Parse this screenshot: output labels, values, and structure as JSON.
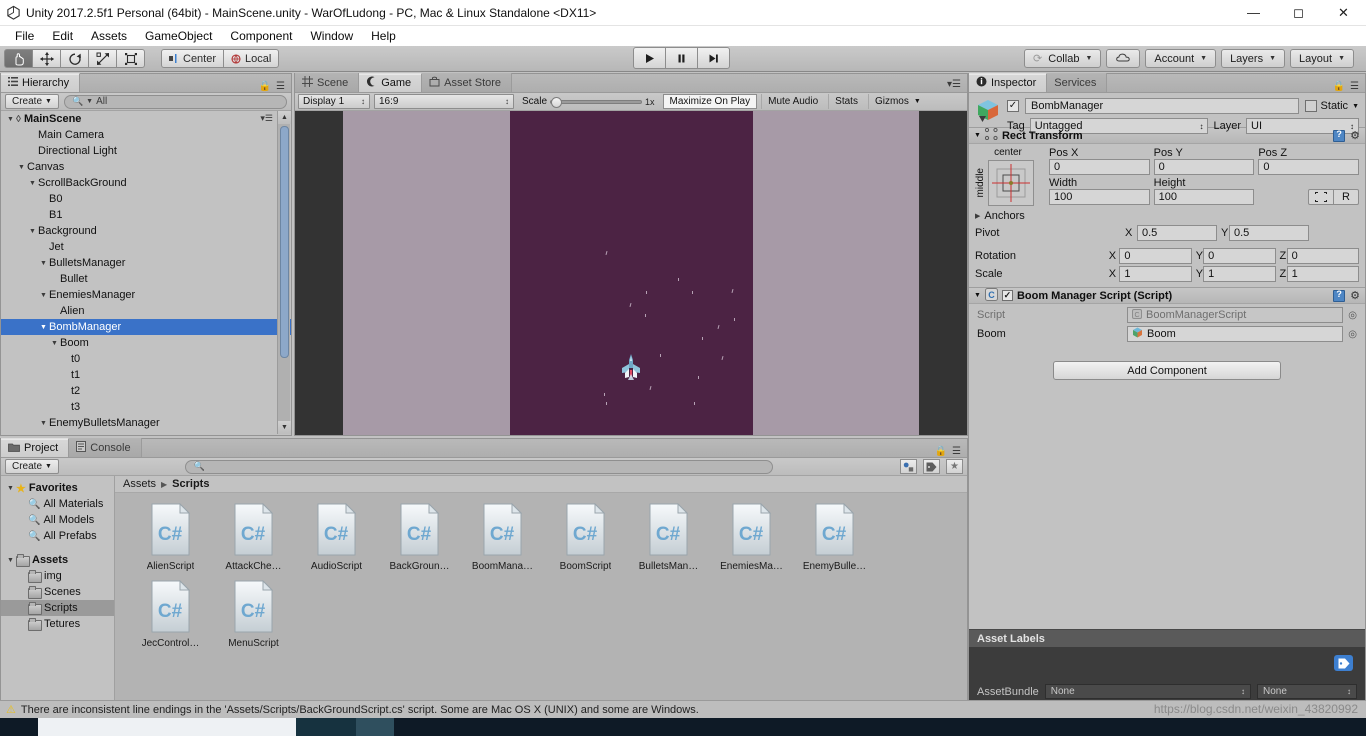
{
  "window": {
    "title": "Unity 2017.2.5f1 Personal (64bit) - MainScene.unity - WarOfLudong - PC, Mac & Linux Standalone <DX11>",
    "logo_icon": "unity-logo-icon",
    "minimize_icon": "minimize-icon",
    "maximize_icon": "maximize-icon",
    "close_icon": "close-icon"
  },
  "menubar": {
    "items": [
      "File",
      "Edit",
      "Assets",
      "GameObject",
      "Component",
      "Window",
      "Help"
    ]
  },
  "toolbar": {
    "tools": [
      {
        "name": "hand-tool",
        "icon": "✋",
        "active": true
      },
      {
        "name": "move-tool",
        "icon": "✥",
        "active": false
      },
      {
        "name": "rotate-tool",
        "icon": "↻",
        "active": false
      },
      {
        "name": "scale-tool",
        "icon": "⤢",
        "active": false
      },
      {
        "name": "rect-tool",
        "icon": "▣",
        "active": false
      }
    ],
    "pivot_mode": "Center",
    "pivot_rotation": "Local",
    "play": "▶",
    "pause": "❙❙",
    "step": "▶❙",
    "collab": "Collab",
    "cloud_icon": "cloud-icon",
    "account": "Account",
    "layers": "Layers",
    "layout": "Layout"
  },
  "hierarchy": {
    "tab": "Hierarchy",
    "create_button": "Create",
    "search_placeholder": "All",
    "rows": [
      {
        "label": "MainScene",
        "depth": 0,
        "arrow": "▼",
        "root": true,
        "selected": false
      },
      {
        "label": "Main Camera",
        "depth": 2,
        "arrow": "",
        "root": false,
        "selected": false
      },
      {
        "label": "Directional Light",
        "depth": 2,
        "arrow": "",
        "root": false,
        "selected": false
      },
      {
        "label": "Canvas",
        "depth": 1,
        "arrow": "▼",
        "root": false,
        "selected": false
      },
      {
        "label": "ScrollBackGround",
        "depth": 2,
        "arrow": "▼",
        "root": false,
        "selected": false
      },
      {
        "label": "B0",
        "depth": 3,
        "arrow": "",
        "root": false,
        "selected": false
      },
      {
        "label": "B1",
        "depth": 3,
        "arrow": "",
        "root": false,
        "selected": false
      },
      {
        "label": "Background",
        "depth": 2,
        "arrow": "▼",
        "root": false,
        "selected": false
      },
      {
        "label": "Jet",
        "depth": 3,
        "arrow": "",
        "root": false,
        "selected": false
      },
      {
        "label": "BulletsManager",
        "depth": 3,
        "arrow": "▼",
        "root": false,
        "selected": false
      },
      {
        "label": "Bullet",
        "depth": 4,
        "arrow": "",
        "root": false,
        "selected": false
      },
      {
        "label": "EnemiesManager",
        "depth": 3,
        "arrow": "▼",
        "root": false,
        "selected": false
      },
      {
        "label": "Alien",
        "depth": 4,
        "arrow": "",
        "root": false,
        "selected": false
      },
      {
        "label": "BombManager",
        "depth": 3,
        "arrow": "▼",
        "root": false,
        "selected": true
      },
      {
        "label": "Boom",
        "depth": 4,
        "arrow": "▼",
        "root": false,
        "selected": false
      },
      {
        "label": "t0",
        "depth": 5,
        "arrow": "",
        "root": false,
        "selected": false
      },
      {
        "label": "t1",
        "depth": 5,
        "arrow": "",
        "root": false,
        "selected": false
      },
      {
        "label": "t2",
        "depth": 5,
        "arrow": "",
        "root": false,
        "selected": false
      },
      {
        "label": "t3",
        "depth": 5,
        "arrow": "",
        "root": false,
        "selected": false
      },
      {
        "label": "EnemyBulletsManager",
        "depth": 3,
        "arrow": "▼",
        "root": false,
        "selected": false
      }
    ]
  },
  "gamepanel": {
    "tabs": [
      {
        "label": "Scene",
        "icon": "grid-icon",
        "active": false
      },
      {
        "label": "Game",
        "icon": "gamepad-icon",
        "active": true
      },
      {
        "label": "Asset Store",
        "icon": "store-icon",
        "active": false
      }
    ],
    "display": "Display 1",
    "aspect": "16:9",
    "scale_label": "Scale",
    "scale_value": "1x",
    "maximize_on_play": "Maximize On Play",
    "mute_audio": "Mute Audio",
    "stats": "Stats",
    "gizmos": "Gizmos"
  },
  "inspector": {
    "tabs": [
      {
        "label": "Inspector",
        "active": true
      },
      {
        "label": "Services",
        "active": false
      }
    ],
    "object_name": "BombManager",
    "enabled": true,
    "static_label": "Static",
    "tag_label": "Tag",
    "tag_value": "Untagged",
    "layer_label": "Layer",
    "layer_value": "UI",
    "rect_transform": {
      "title": "Rect Transform",
      "anchor_preset_top": "center",
      "anchor_preset_side": "middle",
      "pos_x_label": "Pos X",
      "pos_x": "0",
      "pos_y_label": "Pos Y",
      "pos_y": "0",
      "pos_z_label": "Pos Z",
      "pos_z": "0",
      "width_label": "Width",
      "width": "100",
      "height_label": "Height",
      "height": "100",
      "blueprint_button": "blueprint-mode",
      "raw_button": "R",
      "anchors_label": "Anchors",
      "pivot_label": "Pivot",
      "pivot_x": "0.5",
      "pivot_y": "0.5",
      "rotation_label": "Rotation",
      "rot_x": "0",
      "rot_y": "0",
      "rot_z": "0",
      "scale_label": "Scale",
      "scale_x": "1",
      "scale_y": "1",
      "scale_z": "1"
    },
    "script_component": {
      "title": "Boom Manager Script (Script)",
      "enabled": true,
      "script_label": "Script",
      "script_value": "BoomManagerScript",
      "boom_label": "Boom",
      "boom_value": "Boom"
    },
    "add_component": "Add Component",
    "asset_labels_title": "Asset Labels",
    "assetbundle_label": "AssetBundle",
    "assetbundle_value": "None",
    "assetbundle_variant": "None"
  },
  "project": {
    "tabs": [
      {
        "label": "Project",
        "icon": "folder-icon",
        "active": true
      },
      {
        "label": "Console",
        "icon": "console-icon",
        "active": false
      }
    ],
    "create_button": "Create",
    "search_placeholder": "",
    "tree": [
      {
        "label": "Favorites",
        "type": "star",
        "depth": 0,
        "arrow": "▼",
        "bold": true,
        "selected": false
      },
      {
        "label": "All Materials",
        "type": "search",
        "depth": 1,
        "arrow": "",
        "bold": false,
        "selected": false
      },
      {
        "label": "All Models",
        "type": "search",
        "depth": 1,
        "arrow": "",
        "bold": false,
        "selected": false
      },
      {
        "label": "All Prefabs",
        "type": "search",
        "depth": 1,
        "arrow": "",
        "bold": false,
        "selected": false
      },
      {
        "label": "",
        "type": "spacer",
        "depth": 0,
        "arrow": "",
        "bold": false,
        "selected": false
      },
      {
        "label": "Assets",
        "type": "folder",
        "depth": 0,
        "arrow": "▼",
        "bold": true,
        "selected": false
      },
      {
        "label": "img",
        "type": "folder",
        "depth": 1,
        "arrow": "",
        "bold": false,
        "selected": false
      },
      {
        "label": "Scenes",
        "type": "folder",
        "depth": 1,
        "arrow": "",
        "bold": false,
        "selected": false
      },
      {
        "label": "Scripts",
        "type": "folder",
        "depth": 1,
        "arrow": "",
        "bold": false,
        "selected": true
      },
      {
        "label": "Tetures",
        "type": "folder",
        "depth": 1,
        "arrow": "",
        "bold": false,
        "selected": false
      }
    ],
    "breadcrumb": [
      "Assets",
      "Scripts"
    ],
    "assets": [
      {
        "name": "AlienScript",
        "type": "C#"
      },
      {
        "name": "AttackChe…",
        "type": "C#"
      },
      {
        "name": "AudioScript",
        "type": "C#"
      },
      {
        "name": "BackGroun…",
        "type": "C#"
      },
      {
        "name": "BoomMana…",
        "type": "C#"
      },
      {
        "name": "BoomScript",
        "type": "C#"
      },
      {
        "name": "BulletsMan…",
        "type": "C#"
      },
      {
        "name": "EnemiesMa…",
        "type": "C#"
      },
      {
        "name": "EnemyBulle…",
        "type": "C#"
      },
      {
        "name": "JecControl…",
        "type": "C#"
      },
      {
        "name": "MenuScript",
        "type": "C#"
      }
    ]
  },
  "statusbar": {
    "warning_icon": "warning-icon",
    "message": "There are inconsistent line endings in the 'Assets/Scripts/BackGroundScript.cs' script. Some are Mac OS X (UNIX) and some are Windows.",
    "watermark": "https://blog.csdn.net/weixin_43820992"
  },
  "colors": {
    "selection_blue": "#3a72c8",
    "panel_gray": "#c2c2c2",
    "game_bg": "#4c2344",
    "game_side": "#a79aa7",
    "accent_blue": "#3d7fd0"
  }
}
